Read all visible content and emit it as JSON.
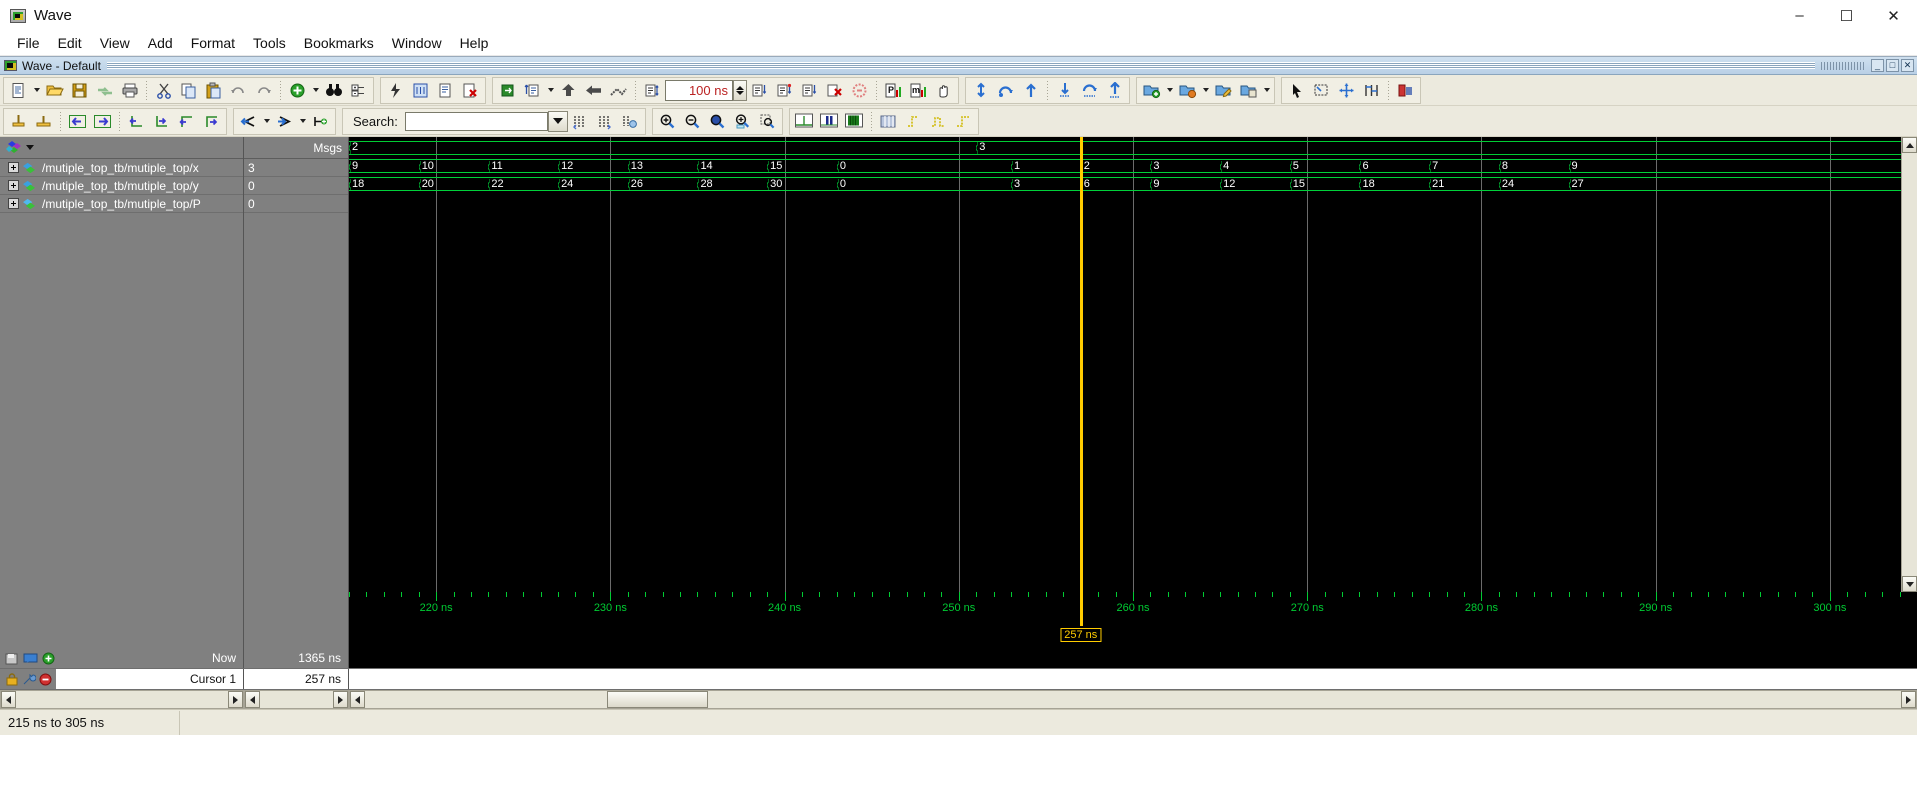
{
  "window": {
    "title": "Wave",
    "app_icon": "wave-app-icon",
    "minimize": "–",
    "maximize": "☐",
    "close": "✕"
  },
  "menubar": {
    "items": [
      {
        "label": "File",
        "name": "menu-file"
      },
      {
        "label": "Edit",
        "name": "menu-edit"
      },
      {
        "label": "View",
        "name": "menu-view"
      },
      {
        "label": "Add",
        "name": "menu-add"
      },
      {
        "label": "Format",
        "name": "menu-format"
      },
      {
        "label": "Tools",
        "name": "menu-tools"
      },
      {
        "label": "Bookmarks",
        "name": "menu-bookmarks"
      },
      {
        "label": "Window",
        "name": "menu-window"
      },
      {
        "label": "Help",
        "name": "menu-help"
      }
    ]
  },
  "mdi": {
    "title": "Wave - Default",
    "minimize": "_",
    "restore": "□",
    "close": "✕"
  },
  "toolbar_row1": {
    "groups": [
      {
        "name": "file-group",
        "buttons": [
          {
            "name": "new-document-button",
            "icon": "new-document-icon",
            "has_caret": true
          },
          {
            "name": "open-button",
            "icon": "open-folder-icon"
          },
          {
            "name": "save-button",
            "icon": "floppy-save-icon"
          },
          {
            "name": "reload-button",
            "icon": "reload-icon"
          },
          {
            "name": "print-button",
            "icon": "printer-icon"
          },
          {
            "name": "cut-button",
            "icon": "scissors-icon"
          },
          {
            "name": "copy-button",
            "icon": "copy-icon"
          },
          {
            "name": "paste-button",
            "icon": "paste-icon"
          },
          {
            "name": "undo-button",
            "icon": "undo-icon"
          },
          {
            "name": "redo-button",
            "icon": "redo-icon"
          },
          {
            "name": "add-button",
            "icon": "green-plus-icon",
            "has_caret": true
          },
          {
            "name": "find-button",
            "icon": "binoculars-icon"
          },
          {
            "name": "properties-button",
            "icon": "properties-icon"
          }
        ]
      },
      {
        "name": "simulate-group",
        "buttons": [
          {
            "name": "run-button",
            "icon": "run-lightning-icon"
          },
          {
            "name": "restart-button",
            "icon": "restart-grid-icon"
          },
          {
            "name": "report-button",
            "icon": "report-icon"
          },
          {
            "name": "delete-report-button",
            "icon": "delete-report-icon"
          }
        ]
      },
      {
        "name": "sim-run-group",
        "buttons": [
          {
            "name": "compile-button",
            "icon": "compile-icon"
          },
          {
            "name": "simulate-button",
            "icon": "simulate-icon",
            "has_caret": true
          },
          {
            "name": "step-up-button",
            "icon": "arrow-up-icon"
          },
          {
            "name": "step-back-button",
            "icon": "arrow-left-icon"
          },
          {
            "name": "step-over-button",
            "icon": "step-over-icon"
          },
          {
            "name": "run-length-button",
            "icon": "run-length-icon"
          }
        ]
      },
      {
        "name": "runtime-group",
        "buttons": [
          {
            "name": "run-all-button",
            "icon": "run-all-icon"
          },
          {
            "name": "continue-run-button",
            "icon": "continue-run-icon"
          },
          {
            "name": "step-button",
            "icon": "step-icon"
          },
          {
            "name": "break-button",
            "icon": "break-icon"
          },
          {
            "name": "stop-button",
            "icon": "stop-icon"
          }
        ]
      },
      {
        "name": "window-group",
        "buttons": [
          {
            "name": "profile-button",
            "icon": "profile-p-icon"
          },
          {
            "name": "memory-button",
            "icon": "memory-m-icon"
          },
          {
            "name": "grab-button",
            "icon": "hand-grab-icon"
          }
        ]
      },
      {
        "name": "cursor-nav-group",
        "buttons": [
          {
            "name": "insert-cursor-button",
            "icon": "cursor-insert-icon"
          },
          {
            "name": "cursor-loop-button",
            "icon": "cursor-loop-icon"
          },
          {
            "name": "cursor-up-button",
            "icon": "cursor-up-icon"
          },
          {
            "name": "wave-insert-button",
            "icon": "wave-insert-icon"
          },
          {
            "name": "wave-loop-button",
            "icon": "wave-loop-icon"
          },
          {
            "name": "wave-up-button",
            "icon": "wave-up-icon"
          }
        ]
      },
      {
        "name": "dataset-group",
        "buttons": [
          {
            "name": "dataset-new-button",
            "icon": "dataset-new-icon",
            "has_caret": true
          },
          {
            "name": "dataset-open-button",
            "icon": "dataset-open-icon",
            "has_caret": true
          },
          {
            "name": "dataset-edit-button",
            "icon": "dataset-edit-icon"
          },
          {
            "name": "dataset-save-button",
            "icon": "dataset-save-icon",
            "has_caret": true
          }
        ]
      },
      {
        "name": "select-mode-group",
        "buttons": [
          {
            "name": "select-mode-button",
            "icon": "arrow-pointer-icon"
          },
          {
            "name": "zoom-mode-button",
            "icon": "zoom-select-icon"
          },
          {
            "name": "pan-mode-button",
            "icon": "pan-move-icon"
          },
          {
            "name": "edit-mode-button",
            "icon": "edit-grid-icon"
          },
          {
            "name": "compare-button",
            "icon": "compare-icon"
          }
        ]
      }
    ],
    "run_length": {
      "value": "100 ns",
      "name": "run-length-field"
    }
  },
  "toolbar_row2": {
    "groups": [
      {
        "name": "wave-edit-group",
        "buttons": [
          {
            "name": "insert-signal-button",
            "icon": "insert-signal-icon"
          },
          {
            "name": "insert-group-button",
            "icon": "insert-group-icon"
          },
          {
            "name": "move-left-button",
            "icon": "move-left-icon"
          },
          {
            "name": "move-right-button",
            "icon": "move-right-icon"
          },
          {
            "name": "edit-wave-1-button",
            "icon": "edit-wave-1-icon"
          },
          {
            "name": "edit-wave-2-button",
            "icon": "edit-wave-2-icon"
          },
          {
            "name": "edit-wave-3-button",
            "icon": "edit-wave-3-icon"
          },
          {
            "name": "edit-wave-4-button",
            "icon": "edit-wave-4-icon"
          }
        ]
      },
      {
        "name": "expand-group",
        "buttons": [
          {
            "name": "expand-left-button",
            "icon": "expand-left-icon",
            "has_caret": true
          },
          {
            "name": "expand-right-button",
            "icon": "expand-right-icon",
            "has_caret": true
          },
          {
            "name": "expand-all-button",
            "icon": "expand-all-icon"
          }
        ]
      },
      {
        "name": "search-group",
        "buttons": [
          {
            "name": "search-prev-button",
            "icon": "search-prev-icon"
          },
          {
            "name": "search-next-button",
            "icon": "search-next-icon"
          },
          {
            "name": "search-options-button",
            "icon": "search-options-icon"
          }
        ]
      },
      {
        "name": "zoom-group",
        "buttons": [
          {
            "name": "zoom-in-button",
            "icon": "zoom-in-icon"
          },
          {
            "name": "zoom-out-button",
            "icon": "zoom-out-icon"
          },
          {
            "name": "zoom-full-button",
            "icon": "zoom-full-icon"
          },
          {
            "name": "zoom-cursor-button",
            "icon": "zoom-cursor-icon"
          },
          {
            "name": "zoom-range-button",
            "icon": "zoom-range-icon"
          }
        ]
      },
      {
        "name": "wave-format-group",
        "buttons": [
          {
            "name": "format-analog-button",
            "icon": "format-analog-icon"
          },
          {
            "name": "format-digital-button",
            "icon": "format-digital-icon"
          },
          {
            "name": "format-filled-button",
            "icon": "format-filled-icon"
          },
          {
            "name": "format-pattern-button",
            "icon": "format-pattern-icon"
          },
          {
            "name": "format-rise-button",
            "icon": "format-rise-icon"
          },
          {
            "name": "format-pulse-button",
            "icon": "format-pulse-icon"
          },
          {
            "name": "format-edge-button",
            "icon": "format-edge-icon"
          }
        ]
      }
    ],
    "search": {
      "label": "Search:",
      "value": "",
      "placeholder": ""
    }
  },
  "panes": {
    "names_header": {
      "icon": "wave-objects-icon",
      "caret": "chevron-down-icon"
    },
    "values_header": "Msgs"
  },
  "signals": [
    {
      "name": "/mutiple_top_tb/mutiple_top/x",
      "value": "3",
      "icon": "signal-bus-icon",
      "expandable": true
    },
    {
      "name": "/mutiple_top_tb/mutiple_top/y",
      "value": "0",
      "icon": "signal-bus-icon",
      "expandable": true
    },
    {
      "name": "/mutiple_top_tb/mutiple_top/P",
      "value": "0",
      "icon": "signal-output-icon",
      "expandable": true
    }
  ],
  "chart_data": {
    "type": "waveform",
    "title": "ModelSim Wave Viewport",
    "time_unit": "ns",
    "view_start": 215,
    "view_end": 305,
    "cursor_time": 257,
    "now_time": 1365,
    "axis_major_ticks": [
      220,
      230,
      240,
      250,
      260,
      270,
      280,
      290,
      300
    ],
    "axis_major_labels": [
      "220 ns",
      "230 ns",
      "240 ns",
      "250 ns",
      "260 ns",
      "270 ns",
      "280 ns",
      "290 ns",
      "300 ns"
    ],
    "minor_tick_interval": 1,
    "grid_lines": [
      220,
      230,
      240,
      250,
      260,
      270,
      280,
      290,
      300
    ],
    "series": [
      {
        "name": "/mutiple_top_tb/mutiple_top/x",
        "row": 0,
        "transitions": [
          {
            "time": 215,
            "value": "2"
          },
          {
            "time": 251,
            "value": "3"
          }
        ]
      },
      {
        "name": "/mutiple_top_tb/mutiple_top/y",
        "row": 1,
        "transitions": [
          {
            "time": 215,
            "value": "9"
          },
          {
            "time": 219,
            "value": "10"
          },
          {
            "time": 223,
            "value": "11"
          },
          {
            "time": 227,
            "value": "12"
          },
          {
            "time": 231,
            "value": "13"
          },
          {
            "time": 235,
            "value": "14"
          },
          {
            "time": 239,
            "value": "15"
          },
          {
            "time": 243,
            "value": "0"
          },
          {
            "time": 253,
            "value": "1"
          },
          {
            "time": 257,
            "value": "2"
          },
          {
            "time": 261,
            "value": "3"
          },
          {
            "time": 265,
            "value": "4"
          },
          {
            "time": 269,
            "value": "5"
          },
          {
            "time": 273,
            "value": "6"
          },
          {
            "time": 277,
            "value": "7"
          },
          {
            "time": 281,
            "value": "8"
          },
          {
            "time": 285,
            "value": "9"
          }
        ]
      },
      {
        "name": "/mutiple_top_tb/mutiple_top/P",
        "row": 2,
        "transitions": [
          {
            "time": 215,
            "value": "18"
          },
          {
            "time": 219,
            "value": "20"
          },
          {
            "time": 223,
            "value": "22"
          },
          {
            "time": 227,
            "value": "24"
          },
          {
            "time": 231,
            "value": "26"
          },
          {
            "time": 235,
            "value": "28"
          },
          {
            "time": 239,
            "value": "30"
          },
          {
            "time": 243,
            "value": "0"
          },
          {
            "time": 253,
            "value": "3"
          },
          {
            "time": 257,
            "value": "6"
          },
          {
            "time": 261,
            "value": "9"
          },
          {
            "time": 265,
            "value": "12"
          },
          {
            "time": 269,
            "value": "15"
          },
          {
            "time": 273,
            "value": "18"
          },
          {
            "time": 277,
            "value": "21"
          },
          {
            "time": 281,
            "value": "24"
          },
          {
            "time": 285,
            "value": "27"
          }
        ]
      }
    ],
    "colors": {
      "wave": "#00cc33",
      "text": "#ffffff",
      "cursor": "#ffcc00",
      "background": "#000000",
      "grid": "#6b6b6b"
    }
  },
  "bottom": {
    "now_label": "Now",
    "now_value": "1365 ns",
    "cursor_label": "Cursor 1",
    "cursor_value": "257 ns",
    "cursor_badge": "257 ns",
    "now_icons": [
      "save-now-icon",
      "message-icon",
      "green-add-icon"
    ],
    "cursor_icons": [
      "lock-icon",
      "wrench-icon",
      "delete-cursor-icon"
    ]
  },
  "statusbar": {
    "range_text": "215 ns to 305 ns",
    "secondary": ""
  }
}
